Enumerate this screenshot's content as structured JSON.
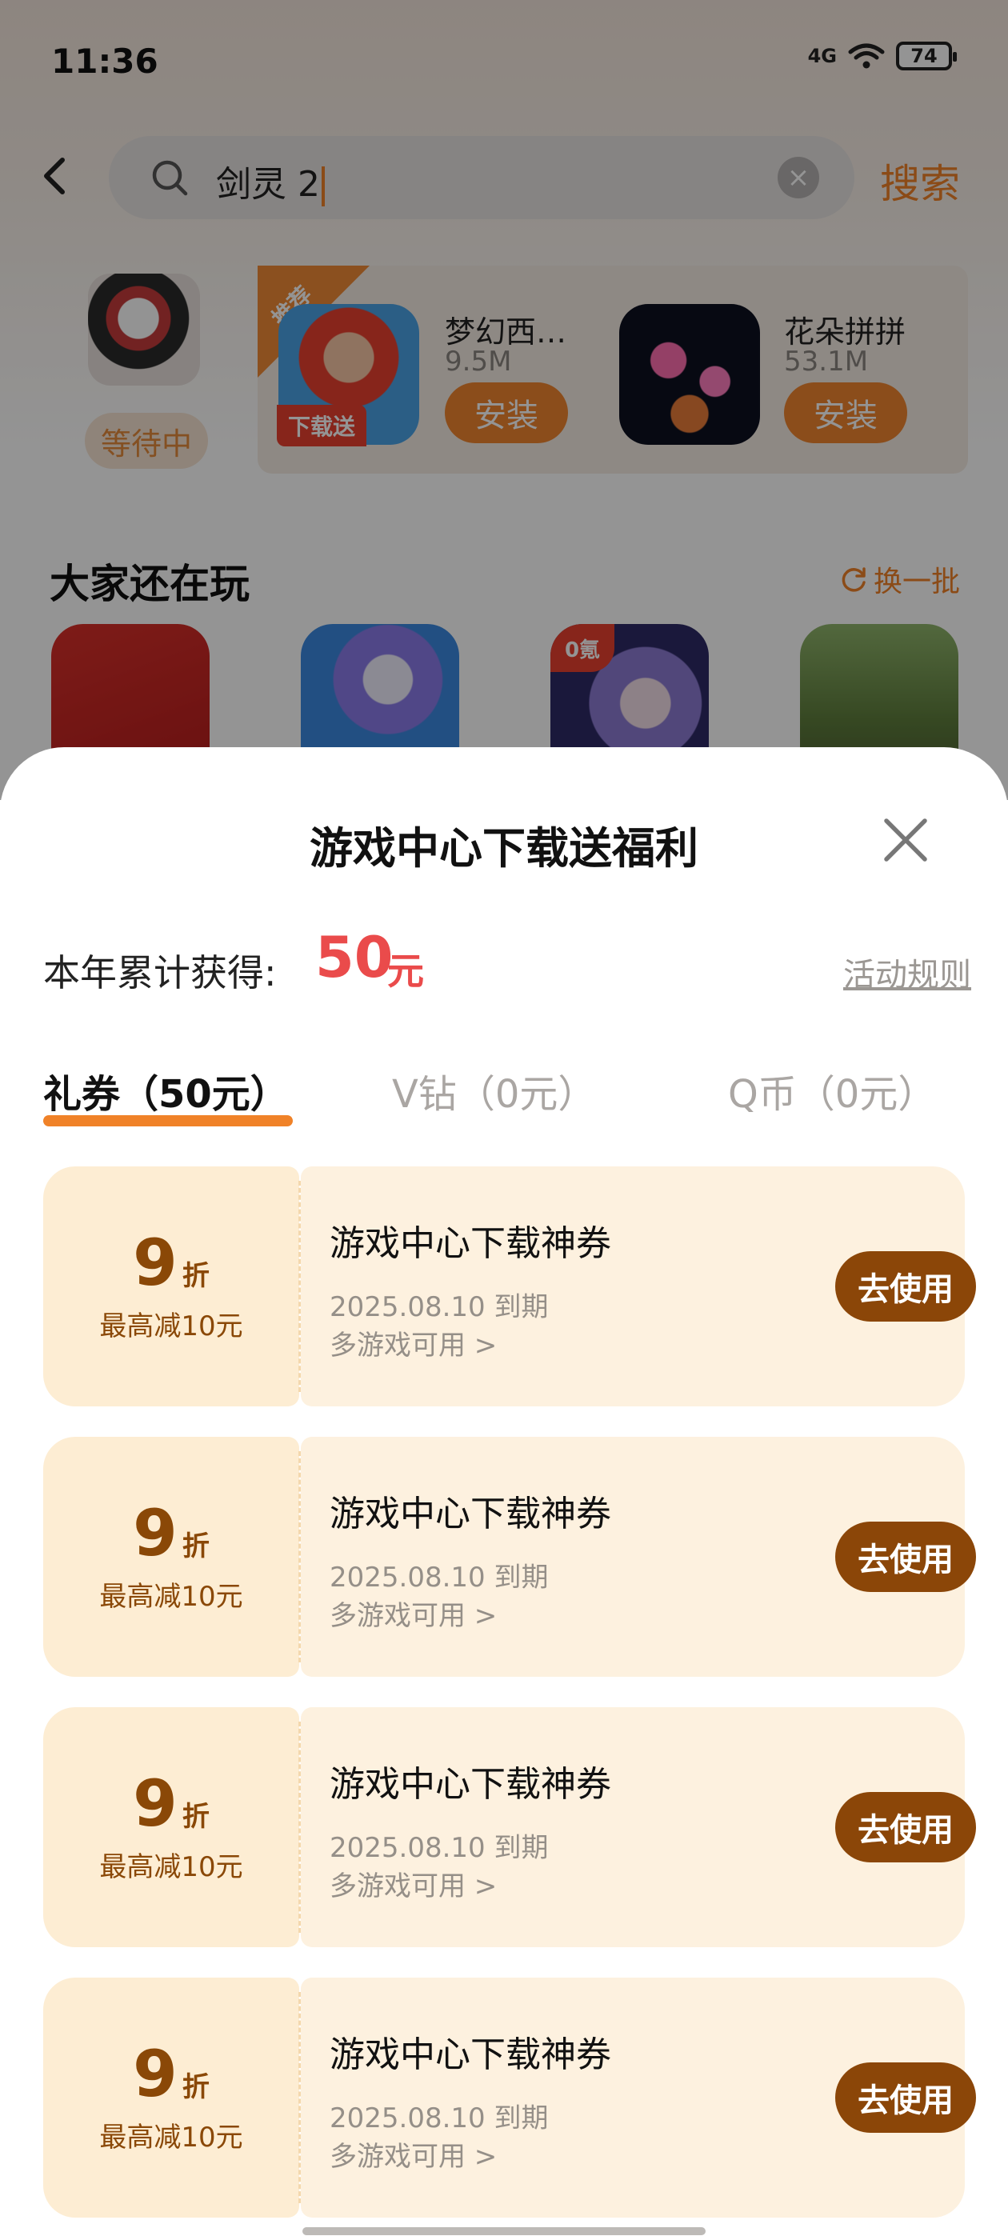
{
  "status": {
    "time": "11:36",
    "network": "4G",
    "battery": "74"
  },
  "search": {
    "query": "剑灵 2",
    "button_label": "搜索"
  },
  "recommend": {
    "waiting_label": "等待中",
    "badge_text": "推荐",
    "apps": [
      {
        "name": "梦幻西…",
        "size": "9.5M",
        "install_label": "安装",
        "tag": "下载送"
      },
      {
        "name": "花朵拼拼",
        "size": "53.1M",
        "install_label": "安装"
      }
    ]
  },
  "also_playing": {
    "title": "大家还在玩",
    "refresh_label": "换一批",
    "game3_tag": "0氪"
  },
  "sheet": {
    "title": "游戏中心下载送福利",
    "total_label": "本年累计获得:",
    "total_amount": "50",
    "total_unit": "元",
    "rules_label": "活动规则",
    "tabs": [
      {
        "label": "礼券（50元）"
      },
      {
        "label": "V钻（0元）"
      },
      {
        "label": "Q币（0元）"
      }
    ],
    "coupons": [
      {
        "discount": "9",
        "discount_unit": "折",
        "max": "最高减10元",
        "title": "游戏中心下载神券",
        "expire": "2025.08.10 到期",
        "scope": "多游戏可用 >",
        "button": "去使用"
      },
      {
        "discount": "9",
        "discount_unit": "折",
        "max": "最高减10元",
        "title": "游戏中心下载神券",
        "expire": "2025.08.10 到期",
        "scope": "多游戏可用 >",
        "button": "去使用"
      },
      {
        "discount": "9",
        "discount_unit": "折",
        "max": "最高减10元",
        "title": "游戏中心下载神券",
        "expire": "2025.08.10 到期",
        "scope": "多游戏可用 >",
        "button": "去使用"
      },
      {
        "discount": "9",
        "discount_unit": "折",
        "max": "最高减10元",
        "title": "游戏中心下载神券",
        "expire": "2025.08.10 到期",
        "scope": "多游戏可用 >",
        "button": "去使用"
      }
    ]
  },
  "colors": {
    "accent": "#f08228",
    "amount": "#ea4b4b",
    "coupon_button": "#8b4608",
    "coupon_bg": "#fdf1df"
  },
  "icons": [
    "back-icon",
    "search-icon",
    "clear-icon",
    "refresh-icon",
    "close-icon",
    "wifi-icon"
  ]
}
